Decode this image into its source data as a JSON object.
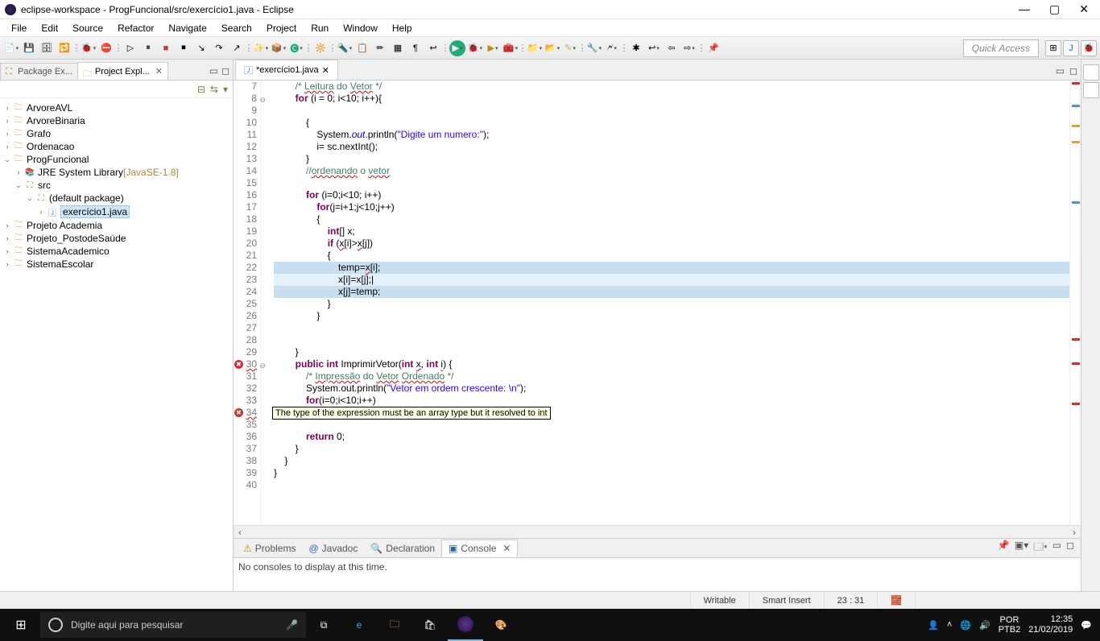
{
  "window": {
    "title": "eclipse-workspace - ProgFuncional/src/exercício1.java - Eclipse"
  },
  "menu": [
    "File",
    "Edit",
    "Source",
    "Refactor",
    "Navigate",
    "Search",
    "Project",
    "Run",
    "Window",
    "Help"
  ],
  "quick_access": "Quick Access",
  "left": {
    "tab_pkg": "Package Ex...",
    "tab_proj": "Project Expl...",
    "nodes": {
      "n1": "ArvoreAVL",
      "n2": "ArvoreBinaria",
      "n3": "Grafo",
      "n4": "Ordenacao",
      "n5": "ProgFuncional",
      "n5a": "JRE System Library",
      "n5a_v": "[JavaSE-1.8]",
      "n5b": "src",
      "n5b1": "(default package)",
      "n5b1a": "exercício1.java",
      "n6": "Projeto Academia",
      "n7": "Projeto_PostodeSaúde",
      "n8": "SistemaAcademico",
      "n9": "SistemaEscolar"
    }
  },
  "editor": {
    "tab": "*exercício1.java",
    "tooltip": "The type of the expression must be an array type but it resolved to int",
    "cursor": "|"
  },
  "code": {
    "l7": "        /* Leitura do Vetor */",
    "l8": "        for (i = 0; i<10; i++){",
    "l9": "",
    "l10": "            {",
    "l11": "                System.out.println(\"Digite um numero:\");",
    "l12": "                i= sc.nextInt();",
    "l13": "            }",
    "l14": "            //ordenando o vetor",
    "l15": "",
    "l16": "            for (i=0;i<10; i++)",
    "l17": "                for(j=i+1;j<10;j++)",
    "l18": "                {",
    "l19": "                    int[] x;",
    "l20": "                    if (x[i]>x[j])",
    "l21": "                    {",
    "l22": "                        temp=x[i];",
    "l23": "                        x[i]=x[j];",
    "l24": "                        x[j]=temp;",
    "l25": "                    }",
    "l26": "                }",
    "l27": "",
    "l28": "",
    "l29": "        }",
    "l30": "        public int ImprimirVetor(int x, int i) {",
    "l31": "            /* Impressão do Vetor Ordenado */",
    "l32": "            System.out.println(\"Vetor em ordem crescente: \\n\");",
    "l33": "            for(i=0;i<10;i++)",
    "l34": "",
    "l35": "",
    "l36": "            return 0;",
    "l37": "        }",
    "l38": "    }",
    "l39": "}",
    "l40": ""
  },
  "lnums": {
    "7": "7",
    "8": "8",
    "9": "9",
    "10": "10",
    "11": "11",
    "12": "12",
    "13": "13",
    "14": "14",
    "15": "15",
    "16": "16",
    "17": "17",
    "18": "18",
    "19": "19",
    "20": "20",
    "21": "21",
    "22": "22",
    "23": "23",
    "24": "24",
    "25": "25",
    "26": "26",
    "27": "27",
    "28": "28",
    "29": "29",
    "30": "30",
    "31": "31",
    "32": "32",
    "33": "33",
    "34": "34",
    "35": "35",
    "36": "36",
    "37": "37",
    "38": "38",
    "39": "39",
    "40": "40"
  },
  "bottom": {
    "problems": "Problems",
    "javadoc": "Javadoc",
    "declaration": "Declaration",
    "console": "Console",
    "msg": "No consoles to display at this time."
  },
  "status": {
    "writable": "Writable",
    "insert": "Smart Insert",
    "pos": "23 : 31"
  },
  "taskbar": {
    "search_placeholder": "Digite aqui para pesquisar",
    "lang1": "POR",
    "lang2": "PTB2",
    "time": "12:35",
    "date": "21/02/2019"
  }
}
